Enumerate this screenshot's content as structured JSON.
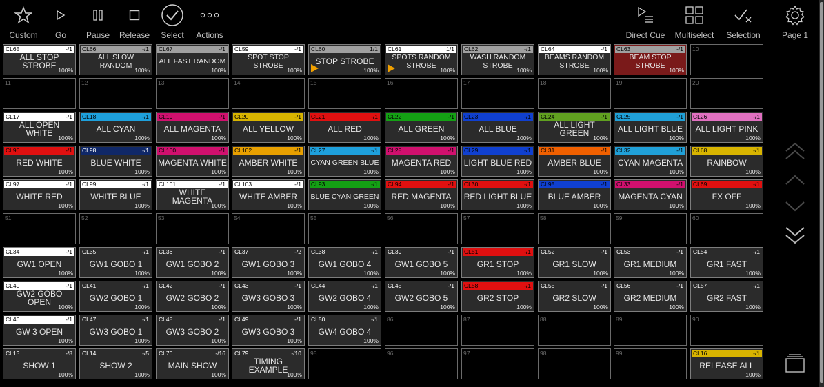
{
  "toolbar": {
    "custom": "Custom",
    "go": "Go",
    "pause": "Pause",
    "release": "Release",
    "select": "Select",
    "actions": "Actions",
    "direct_cue": "Direct Cue",
    "multiselect": "Multiselect",
    "selection": "Selection",
    "page": "Page 1"
  },
  "icons": [
    "star-icon",
    "play-icon",
    "pause-icon",
    "stop-square-icon",
    "check-circle-icon",
    "more-dots-icon",
    "direct-cue-icon",
    "multiselect-grid-icon",
    "selection-check-icon",
    "gear-icon",
    "chevron-double-up-icon",
    "chevron-up-icon",
    "chevron-down-icon",
    "chevron-double-down-icon",
    "stack-icon"
  ],
  "cells": [
    {
      "id": "CL65",
      "count": "-/1",
      "name": "ALL STOP STROBE",
      "pct": "100%",
      "color": "#ffffff"
    },
    {
      "id": "CL66",
      "count": "-/1",
      "name": "ALL SLOW RANDOM",
      "pct": "100%",
      "color": "#a0a0a0",
      "small": true
    },
    {
      "id": "CL67",
      "count": "-/1",
      "name": "ALL FAST RANDOM",
      "pct": "100%",
      "color": "#a0a0a0",
      "small": true
    },
    {
      "id": "CL59",
      "count": "-/1",
      "name": "SPOT STOP STROBE",
      "pct": "100%",
      "color": "#ffffff",
      "small": true
    },
    {
      "id": "CL60",
      "count": "1/1",
      "name": "STOP STROBE",
      "pct": "100%",
      "color": "#a0a0a0",
      "play": true
    },
    {
      "id": "CL61",
      "count": "1/1",
      "name": "SPOTS RANDOM STROBE",
      "pct": "100%",
      "color": "#ffffff",
      "small": true,
      "play": true
    },
    {
      "id": "CL62",
      "count": "-/1",
      "name": "WASH RANDOM STROBE",
      "pct": "100%",
      "color": "#a0a0a0",
      "small": true
    },
    {
      "id": "CL64",
      "count": "-/1",
      "name": "BEAMS RANDOM STROBE",
      "pct": "100%",
      "color": "#ffffff",
      "small": true
    },
    {
      "id": "CL63",
      "count": "-/1",
      "name": "BEAM STOP STROBE",
      "pct": "100%",
      "color": "#a0a0a0",
      "small": true,
      "hl": true
    },
    {
      "num": "10"
    },
    {
      "num": "11"
    },
    {
      "num": "12"
    },
    {
      "num": "13"
    },
    {
      "num": "14"
    },
    {
      "num": "15"
    },
    {
      "num": "16"
    },
    {
      "num": "17"
    },
    {
      "num": "18"
    },
    {
      "num": "19"
    },
    {
      "num": "20"
    },
    {
      "id": "CL17",
      "count": "-/1",
      "name": "ALL OPEN WHITE",
      "pct": "100%",
      "color": "#ffffff"
    },
    {
      "id": "CL18",
      "count": "-/1",
      "name": "ALL CYAN",
      "pct": "100%",
      "color": "#1ea0dc"
    },
    {
      "id": "CL19",
      "count": "-/1",
      "name": "ALL MAGENTA",
      "pct": "100%",
      "color": "#d0106e"
    },
    {
      "id": "CL20",
      "count": "-/1",
      "name": "ALL YELLOW",
      "pct": "100%",
      "color": "#d8b400"
    },
    {
      "id": "CL21",
      "count": "-/1",
      "name": "ALL RED",
      "pct": "100%",
      "color": "#e01010"
    },
    {
      "id": "CL22",
      "count": "-/1",
      "name": "ALL GREEN",
      "pct": "100%",
      "color": "#14a014"
    },
    {
      "id": "CL23",
      "count": "-/1",
      "name": "ALL BLUE",
      "pct": "100%",
      "color": "#1040d0"
    },
    {
      "id": "CL24",
      "count": "-/1",
      "name": "ALL LIGHT GREEN",
      "pct": "100%",
      "color": "#60a020"
    },
    {
      "id": "CL25",
      "count": "-/1",
      "name": "ALL LIGHT BLUE",
      "pct": "100%",
      "color": "#20a0d8"
    },
    {
      "id": "CL26",
      "count": "-/1",
      "name": "ALL LIGHT PINK",
      "pct": "100%",
      "color": "#e070c0"
    },
    {
      "id": "CL96",
      "count": "-/1",
      "name": "RED WHITE",
      "pct": "100%",
      "color": "#e01010"
    },
    {
      "id": "CL98",
      "count": "-/1",
      "name": "BLUE WHITE",
      "pct": "100%",
      "color": "#102868",
      "dark": true
    },
    {
      "id": "CL100",
      "count": "-/1",
      "name": "MAGENTA WHITE",
      "pct": "100%",
      "color": "#d0106e"
    },
    {
      "id": "CL102",
      "count": "-/1",
      "name": "AMBER WHITE",
      "pct": "100%",
      "color": "#e8a000"
    },
    {
      "id": "CL27",
      "count": "-/1",
      "name": "CYAN GREEN BLUE",
      "pct": "100%",
      "color": "#1ea0dc",
      "small": true
    },
    {
      "id": "CL28",
      "count": "-/1",
      "name": "MAGENTA RED",
      "pct": "100%",
      "color": "#d0106e"
    },
    {
      "id": "CL29",
      "count": "-/1",
      "name": "LIGHT BLUE RED",
      "pct": "100%",
      "color": "#1040d0"
    },
    {
      "id": "CL31",
      "count": "-/1",
      "name": "AMBER BLUE",
      "pct": "100%",
      "color": "#f06000"
    },
    {
      "id": "CL32",
      "count": "-/1",
      "name": "CYAN MAGENTA",
      "pct": "100%",
      "color": "#20a0d8"
    },
    {
      "id": "CL68",
      "count": "-/1",
      "name": "RAINBOW",
      "pct": "100%",
      "color": "#d8b400"
    },
    {
      "id": "CL97",
      "count": "-/1",
      "name": "WHITE RED",
      "pct": "100%",
      "color": "#ffffff"
    },
    {
      "id": "CL99",
      "count": "-/1",
      "name": "WHITE BLUE",
      "pct": "100%",
      "color": "#ffffff"
    },
    {
      "id": "CL101",
      "count": "-/1",
      "name": "WHITE MAGENTA",
      "pct": "100%",
      "color": "#ffffff"
    },
    {
      "id": "CL103",
      "count": "-/1",
      "name": "WHITE AMBER",
      "pct": "100%",
      "color": "#ffffff"
    },
    {
      "id": "CL93",
      "count": "-/1",
      "name": "BLUE CYAN GREEN",
      "pct": "100%",
      "color": "#14a014",
      "small": true
    },
    {
      "id": "CL94",
      "count": "-/1",
      "name": "RED MAGENTA",
      "pct": "100%",
      "color": "#e01010"
    },
    {
      "id": "CL30",
      "count": "-/1",
      "name": "RED LIGHT BLUE",
      "pct": "100%",
      "color": "#e01010"
    },
    {
      "id": "CL95",
      "count": "-/1",
      "name": "BLUE AMBER",
      "pct": "100%",
      "color": "#1040d0"
    },
    {
      "id": "CL33",
      "count": "-/1",
      "name": "MAGENTA CYAN",
      "pct": "100%",
      "color": "#d0106e"
    },
    {
      "id": "CL69",
      "count": "-/1",
      "name": "FX OFF",
      "pct": "100%",
      "color": "#e01010"
    },
    {
      "num": "51"
    },
    {
      "num": "52"
    },
    {
      "num": "53"
    },
    {
      "num": "54"
    },
    {
      "num": "55"
    },
    {
      "num": "56"
    },
    {
      "num": "57"
    },
    {
      "num": "58"
    },
    {
      "num": "59"
    },
    {
      "num": "60"
    },
    {
      "id": "CL34",
      "count": "-/1",
      "name": "GW1 OPEN",
      "pct": "100%",
      "color": "#ffffff"
    },
    {
      "id": "CL35",
      "count": "-/1",
      "name": "GW1 GOBO 1",
      "pct": "100%",
      "color": "#2b2b2b",
      "dark": true
    },
    {
      "id": "CL36",
      "count": "-/1",
      "name": "GW1 GOBO 2",
      "pct": "100%",
      "color": "#2b2b2b",
      "dark": true
    },
    {
      "id": "CL37",
      "count": "-/2",
      "name": "GW1 GOBO 3",
      "pct": "100%",
      "color": "#2b2b2b",
      "dark": true
    },
    {
      "id": "CL38",
      "count": "-/1",
      "name": "GW1 GOBO 4",
      "pct": "100%",
      "color": "#2b2b2b",
      "dark": true
    },
    {
      "id": "CL39",
      "count": "-/1",
      "name": "GW1 GOBO 5",
      "pct": "100%",
      "color": "#2b2b2b",
      "dark": true
    },
    {
      "id": "CL51",
      "count": "-/1",
      "name": "GR1 STOP",
      "pct": "100%",
      "color": "#e01010"
    },
    {
      "id": "CL52",
      "count": "-/1",
      "name": "GR1 SLOW",
      "pct": "100%",
      "color": "#2b2b2b",
      "dark": true
    },
    {
      "id": "CL53",
      "count": "-/1",
      "name": "GR1 MEDIUM",
      "pct": "100%",
      "color": "#2b2b2b",
      "dark": true
    },
    {
      "id": "CL54",
      "count": "-/1",
      "name": "GR1 FAST",
      "pct": "100%",
      "color": "#2b2b2b",
      "dark": true
    },
    {
      "id": "CL40",
      "count": "-/1",
      "name": "GW2 GOBO OPEN",
      "pct": "100%",
      "color": "#ffffff"
    },
    {
      "id": "CL41",
      "count": "-/1",
      "name": "GW2 GOBO 1",
      "pct": "100%",
      "color": "#2b2b2b",
      "dark": true
    },
    {
      "id": "CL42",
      "count": "-/1",
      "name": "GW2 GOBO 2",
      "pct": "100%",
      "color": "#2b2b2b",
      "dark": true
    },
    {
      "id": "CL43",
      "count": "-/1",
      "name": "GW3 GOBO 3",
      "pct": "100%",
      "color": "#2b2b2b",
      "dark": true
    },
    {
      "id": "CL44",
      "count": "-/1",
      "name": "GW2 GOBO 4",
      "pct": "100%",
      "color": "#2b2b2b",
      "dark": true
    },
    {
      "id": "CL45",
      "count": "-/1",
      "name": "GW2 GOBO 5",
      "pct": "100%",
      "color": "#2b2b2b",
      "dark": true
    },
    {
      "id": "CL58",
      "count": "-/1",
      "name": "GR2 STOP",
      "pct": "100%",
      "color": "#e01010"
    },
    {
      "id": "CL55",
      "count": "-/1",
      "name": "GR2 SLOW",
      "pct": "100%",
      "color": "#2b2b2b",
      "dark": true
    },
    {
      "id": "CL56",
      "count": "-/1",
      "name": "GR2 MEDIUM",
      "pct": "100%",
      "color": "#2b2b2b",
      "dark": true
    },
    {
      "id": "CL57",
      "count": "-/1",
      "name": "GR2 FAST",
      "pct": "100%",
      "color": "#2b2b2b",
      "dark": true
    },
    {
      "id": "CL46",
      "count": "-/1",
      "name": "GW 3 OPEN",
      "pct": "100%",
      "color": "#ffffff"
    },
    {
      "id": "CL47",
      "count": "-/1",
      "name": "GW3 GOBO 1",
      "pct": "100%",
      "color": "#2b2b2b",
      "dark": true
    },
    {
      "id": "CL48",
      "count": "-/1",
      "name": "GW3 GOBO 2",
      "pct": "100%",
      "color": "#2b2b2b",
      "dark": true
    },
    {
      "id": "CL49",
      "count": "-/1",
      "name": "GW3 GOBO 3",
      "pct": "100%",
      "color": "#2b2b2b",
      "dark": true
    },
    {
      "id": "CL50",
      "count": "-/1",
      "name": "GW4 GOBO 4",
      "pct": "100%",
      "color": "#2b2b2b",
      "dark": true
    },
    {
      "num": "86"
    },
    {
      "num": "87"
    },
    {
      "num": "88"
    },
    {
      "num": "89"
    },
    {
      "num": "90"
    },
    {
      "id": "CL13",
      "count": "-/8",
      "name": "SHOW 1",
      "pct": "100%",
      "color": "#2b2b2b",
      "dark": true
    },
    {
      "id": "CL14",
      "count": "-/5",
      "name": "SHOW 2",
      "pct": "100%",
      "color": "#2b2b2b",
      "dark": true
    },
    {
      "id": "CL70",
      "count": "-/16",
      "name": "MAIN SHOW",
      "pct": "100%",
      "color": "#2b2b2b",
      "dark": true
    },
    {
      "id": "CL79",
      "count": "-/10",
      "name": "TIMING EXAMPLE",
      "pct": "100%",
      "color": "#2b2b2b",
      "dark": true
    },
    {
      "num": "95"
    },
    {
      "num": "96"
    },
    {
      "num": "97"
    },
    {
      "num": "98"
    },
    {
      "num": "99"
    },
    {
      "id": "CL16",
      "count": "-/1",
      "name": "RELEASE ALL",
      "pct": "100%",
      "color": "#d8b400"
    }
  ]
}
